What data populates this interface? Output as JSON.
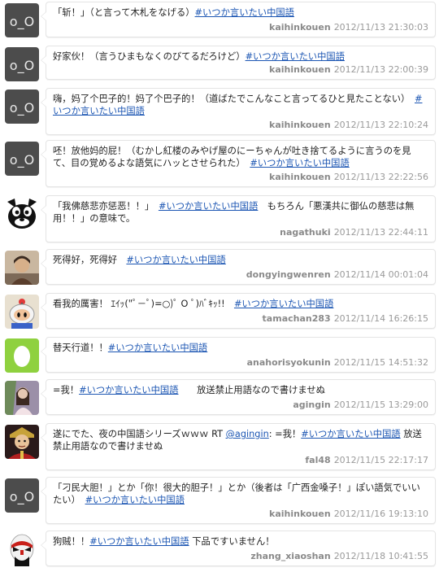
{
  "tweets": [
    {
      "user": "kaihinkouen",
      "time": "2012/11/13 21:30:03",
      "pre": "「斩！」（と言って木札をなげる）",
      "tag": "#いつか言いたい中国語",
      "mid": "",
      "tag2": "",
      "post": ""
    },
    {
      "user": "kaihinkouen",
      "time": "2012/11/13 22:00:39",
      "pre": "好家伙！（言うひまもなくのびてるだろけど）",
      "tag": "#いつか言いたい中国語",
      "mid": "",
      "tag2": "",
      "post": ""
    },
    {
      "user": "kaihinkouen",
      "time": "2012/11/13 22:10:24",
      "pre": "嗨，妈了个巴子的！妈了个巴子的！（道ばたでこんなこと言ってるひと見たことない）",
      "tag": "#いつか言いたい中国語",
      "mid": "",
      "tag2": "",
      "post": ""
    },
    {
      "user": "kaihinkouen",
      "time": "2012/11/13 22:22:56",
      "pre": "呸！放他妈的屁！（むかし紅楼のみやげ屋のにーちゃんが吐き捨てるように言うのを見て、目の覚めるよな語気にハッとさせられた）",
      "tag": "#いつか言いたい中国語",
      "mid": "",
      "tag2": "",
      "post": ""
    },
    {
      "user": "nagathuki",
      "time": "2012/11/13 22:44:11",
      "pre": "「我佛慈悲亦惩恶！！」",
      "tag": "#いつか言いたい中国語",
      "mid": "",
      "tag2": "",
      "post": "　もちろん「悪漢共に御仏の慈悲は無用！！」の意味で。"
    },
    {
      "user": "dongyingwenren",
      "time": "2012/11/14 00:01:04",
      "pre": "死得好，死得好　",
      "tag": "#いつか言いたい中国語",
      "mid": "",
      "tag2": "",
      "post": ""
    },
    {
      "user": "tamachan283",
      "time": "2012/11/14 16:26:15",
      "pre": "看我的厲害！ ｴｲｯ(\"ﾟ－ﾟ)=○)ﾟ O ﾟ)ﾊﾞｷｯ!!　",
      "tag": "#いつか言いたい中国語",
      "mid": "",
      "tag2": "",
      "post": ""
    },
    {
      "user": "anahorisyokunin",
      "time": "2012/11/15 14:51:32",
      "pre": "替天行道！！",
      "tag": "#いつか言いたい中国語",
      "mid": "",
      "tag2": "",
      "post": ""
    },
    {
      "user": "agingin",
      "time": "2012/11/15 13:29:00",
      "pre": "=我！",
      "tag": "#いつか言いたい中国語",
      "mid": "",
      "tag2": "",
      "post": "　　放送禁止用語なので書けませぬ"
    },
    {
      "user": "fal48",
      "time": "2012/11/15 22:17:17",
      "pre": "遂にでた、夜の中国語シリーズｗｗｗ RT ",
      "tag": "@agingin",
      "mid": ": =我！",
      "tag2": "#いつか言いたい中国語",
      "post": " 放送禁止用語なので書けませぬ"
    },
    {
      "user": "kaihinkouen",
      "time": "2012/11/16 19:13:10",
      "pre": "「刁民大胆！」とか「你！很大的胆子！」とか（後者は「广西金嗓子！」ぽい語気でいいたい）",
      "tag": "#いつか言いたい中国語",
      "mid": "",
      "tag2": "",
      "post": ""
    },
    {
      "user": "zhang_xiaoshan",
      "time": "2012/11/18 10:41:55",
      "pre": "狗贼！！",
      "tag": "#いつか言いたい中国語",
      "mid": "",
      "tag2": "",
      "post": " 下品ですいません！"
    }
  ]
}
